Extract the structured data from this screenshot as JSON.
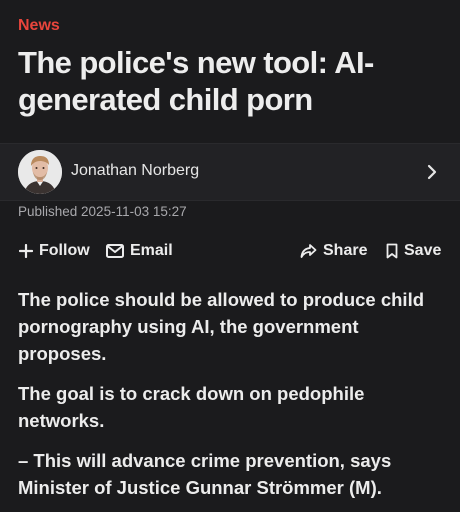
{
  "article": {
    "section": "News",
    "headline": "The police's new tool: AI-generated child porn",
    "author": {
      "name": "Jonathan Norberg"
    },
    "published": "Published 2025-11-03 15:27",
    "paragraphs": [
      "The police should be allowed to produce child pornography using AI, the government proposes.",
      "The goal is to crack down on pedophile networks.",
      "– This will advance crime prevention, says Minister of Justice Gunnar Strömmer (M)."
    ]
  },
  "actions": {
    "follow_label": "Follow",
    "email_label": "Email",
    "share_label": "Share",
    "save_label": "Save"
  },
  "icons": {
    "follow": "plus-icon",
    "email": "envelope-icon",
    "share": "share-arrow-icon",
    "save": "bookmark-icon",
    "author_link": "chevron-right-icon"
  },
  "colors": {
    "background": "#1b1b1d",
    "section_label": "#e8453c",
    "text": "#ececec",
    "muted": "#a8a8ac"
  }
}
